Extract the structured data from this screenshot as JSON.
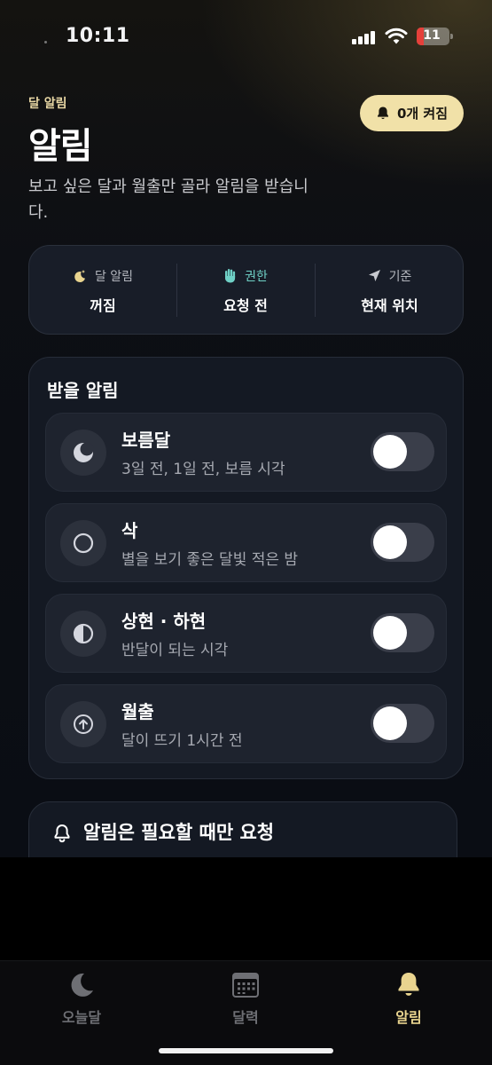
{
  "status_bar": {
    "time": "10:11",
    "battery": "11"
  },
  "header": {
    "eyebrow": "달 알림",
    "title": "알림",
    "description": "보고 싶은 달과 월출만 골라 알림을 받습니다.",
    "on_count_label": "0개 켜짐"
  },
  "summary": [
    {
      "label": "달 알림",
      "value": "꺼짐",
      "icon": "moon-sparkle-icon",
      "icon_color": "#e9d48f"
    },
    {
      "label": "권한",
      "value": "요청 전",
      "icon": "hand-icon",
      "icon_color": "#6fd0c6"
    },
    {
      "label": "기준",
      "value": "현재 위치",
      "icon": "location-arrow-icon",
      "icon_color": "#c7c9cf"
    }
  ],
  "alerts": {
    "title": "받을 알림",
    "items": [
      {
        "name": "보름달",
        "subtitle": "3일 전, 1일 전, 보름 시각",
        "icon": "full-moon-icon",
        "enabled": false
      },
      {
        "name": "삭",
        "subtitle": "별을 보기 좋은 달빛 적은 밤",
        "icon": "new-moon-icon",
        "enabled": false
      },
      {
        "name": "상현 · 하현",
        "subtitle": "반달이 되는 시각",
        "icon": "half-moon-icon",
        "enabled": false
      },
      {
        "name": "월출",
        "subtitle": "달이 뜨기 1시간 전",
        "icon": "moonrise-arrow-icon",
        "enabled": false
      }
    ]
  },
  "info": {
    "title": "알림은 필요할 때만 요청",
    "icon": "bell-outline-icon"
  },
  "tabs": [
    {
      "label": "오늘달",
      "icon": "moon-icon",
      "active": false
    },
    {
      "label": "달력",
      "icon": "calendar-icon",
      "active": false
    },
    {
      "label": "알림",
      "icon": "bell-icon",
      "active": true
    }
  ],
  "colors": {
    "accent": "#e9d48f",
    "pill_bg": "#f1e1a8",
    "teal": "#6fd0c6"
  }
}
